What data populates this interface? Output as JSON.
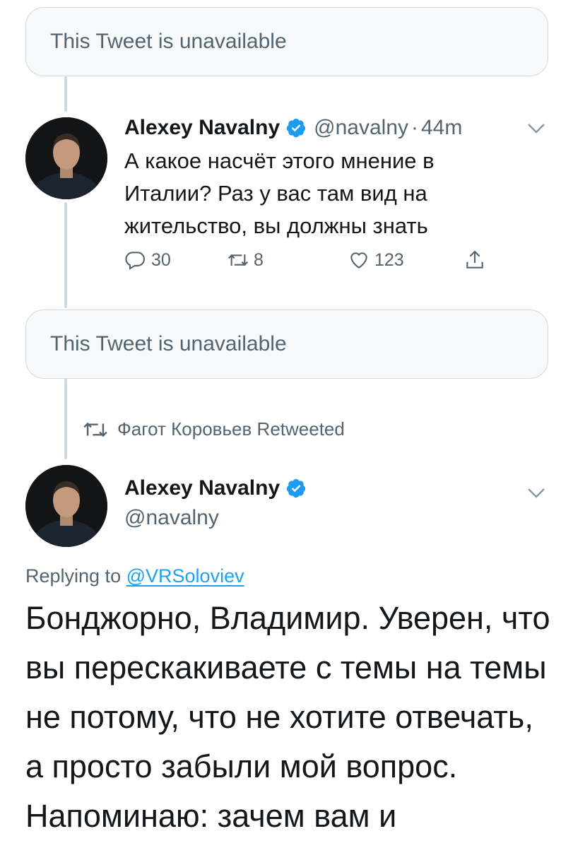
{
  "unavailable_label_1": "This Tweet is unavailable",
  "unavailable_label_2": "This Tweet is unavailable",
  "tweet1": {
    "author_name": "Alexey Navalny",
    "handle": "@navalny",
    "separator": "·",
    "time": "44m",
    "text": "А какое насчёт этого мнение в Италии? Раз у вас там вид на жительство, вы должны знать",
    "reply_count": "30",
    "retweet_count": "8",
    "like_count": "123"
  },
  "retweeted_by": "Фагот Коровьев Retweeted",
  "tweet2": {
    "author_name": "Alexey Navalny",
    "handle": "@navalny",
    "replying_prefix": "Replying to",
    "replying_to": "@VRSoloviev",
    "text": "Бонджорно, Владимир. Уверен, что вы перескакиваете с темы на темы не потому, что не хотите отвечать, а просто забыли мой вопрос. Напоминаю: зачем вам и"
  },
  "colors": {
    "accent": "#1da1f2",
    "secondary_text": "#536471",
    "border": "#cfd9de"
  },
  "icons": [
    "verified-badge-icon",
    "chevron-down-icon",
    "reply-icon",
    "retweet-icon",
    "like-icon",
    "share-icon"
  ]
}
